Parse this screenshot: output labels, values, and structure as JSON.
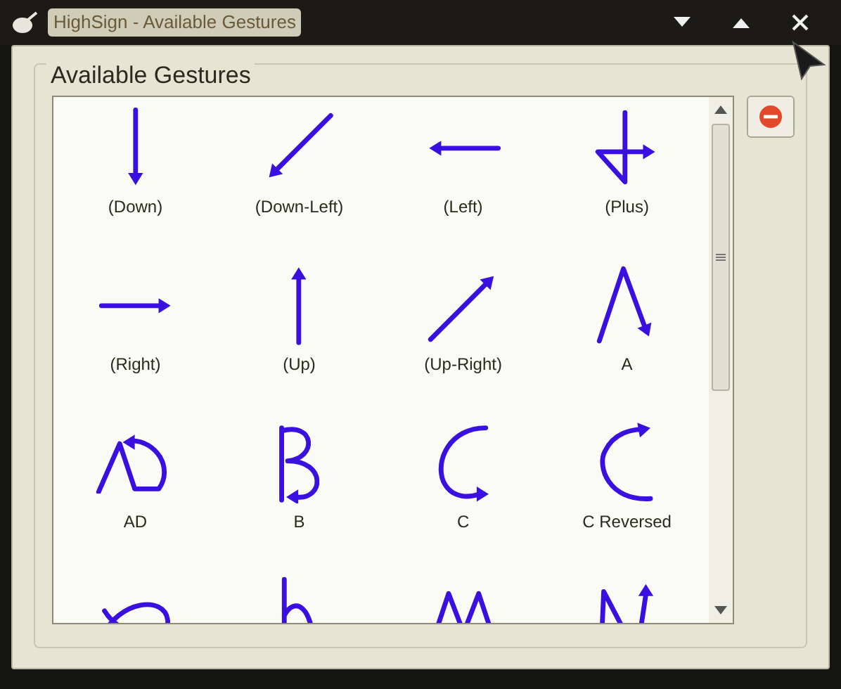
{
  "window": {
    "title": "HighSign - Available Gestures"
  },
  "group": {
    "title": "Available Gestures"
  },
  "gestures": [
    {
      "kind": "down",
      "label": "(Down)"
    },
    {
      "kind": "down-left",
      "label": "(Down-Left)"
    },
    {
      "kind": "left",
      "label": "(Left)"
    },
    {
      "kind": "plus",
      "label": "(Plus)"
    },
    {
      "kind": "right",
      "label": "(Right)"
    },
    {
      "kind": "up",
      "label": "(Up)"
    },
    {
      "kind": "up-right",
      "label": "(Up-Right)"
    },
    {
      "kind": "a",
      "label": "A"
    },
    {
      "kind": "ad",
      "label": "AD"
    },
    {
      "kind": "b",
      "label": "B"
    },
    {
      "kind": "c",
      "label": "C"
    },
    {
      "kind": "c-reversed",
      "label": "C Reversed"
    },
    {
      "kind": "loop"
    },
    {
      "kind": "h"
    },
    {
      "kind": "m"
    },
    {
      "kind": "n-up"
    }
  ]
}
